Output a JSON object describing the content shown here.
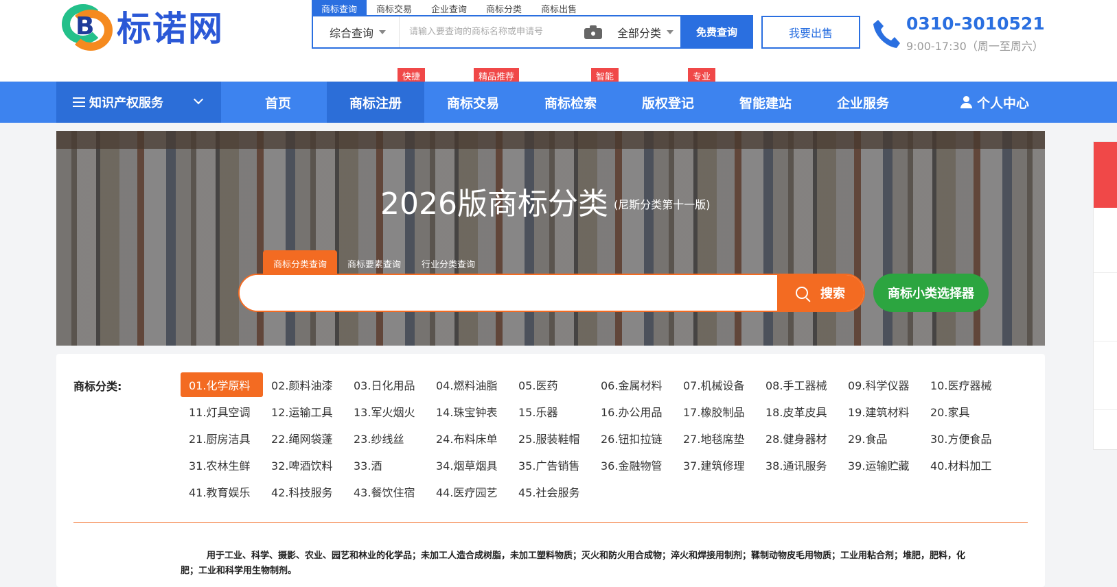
{
  "brand": {
    "name": "标诺网",
    "logo_letter": "B"
  },
  "search": {
    "tabs": [
      "商标查询",
      "商标交易",
      "企业查询",
      "商标分类",
      "商标出售"
    ],
    "type_select": "综合查询",
    "placeholder": "请输入要查询的商标名称或申请号",
    "category_select": "全部分类",
    "submit_label": "免费查询"
  },
  "sell_button": "我要出售",
  "contact": {
    "phone": "0310-3010521",
    "hours": "9:00-17:30（周一至周六）"
  },
  "nav": {
    "ipr_menu": "知识产权服务",
    "items": [
      "首页",
      "商标注册",
      "商标交易",
      "商标检索",
      "版权登记",
      "智能建站",
      "企业服务",
      "个人中心"
    ],
    "badges": [
      "快捷",
      "精品推荐",
      "智能",
      "专业"
    ]
  },
  "banner": {
    "title": "2026版商标分类",
    "subtitle": "(尼斯分类第十一版)",
    "tabs": [
      "商标分类查询",
      "商标要素查询",
      "行业分类查询"
    ],
    "search_button": "搜索",
    "selector_button": "商标小类选择器"
  },
  "classification": {
    "label": "商标分类:",
    "classes": [
      "01.化学原料",
      "02.颜料油漆",
      "03.日化用品",
      "04.燃料油脂",
      "05.医药",
      "06.金属材料",
      "07.机械设备",
      "08.手工器械",
      "09.科学仪器",
      "10.医疗器械",
      "11.灯具空调",
      "12.运输工具",
      "13.军火烟火",
      "14.珠宝钟表",
      "15.乐器",
      "16.办公用品",
      "17.橡胶制品",
      "18.皮革皮具",
      "19.建筑材料",
      "20.家具",
      "21.厨房洁具",
      "22.绳网袋蓬",
      "23.纱线丝",
      "24.布料床单",
      "25.服装鞋帽",
      "26.钮扣拉链",
      "27.地毯席垫",
      "28.健身器材",
      "29.食品",
      "30.方便食品",
      "31.农林生鲜",
      "32.啤酒饮料",
      "33.酒",
      "34.烟草烟具",
      "35.广告销售",
      "36.金融物管",
      "37.建筑修理",
      "38.通讯服务",
      "39.运输贮藏",
      "40.材料加工",
      "41.教育娱乐",
      "42.科技服务",
      "43.餐饮住宿",
      "44.医疗园艺",
      "45.社会服务"
    ],
    "selected_index": 0,
    "description": "用于工业、科学、摄影、农业、园艺和林业的化学品；未加工人造合成树脂，未加工塑料物质；灭火和防火用合成物；淬火和焊接用制剂；鞣制动物皮毛用物质；工业用粘合剂；堆肥，肥料，化肥；工业和科学用生物制剂。"
  },
  "colors": {
    "primary": "#2a6fe0",
    "nav": "#3d83ef",
    "accent": "#f36b22",
    "green": "#2ca540",
    "badge": "#f04848"
  }
}
